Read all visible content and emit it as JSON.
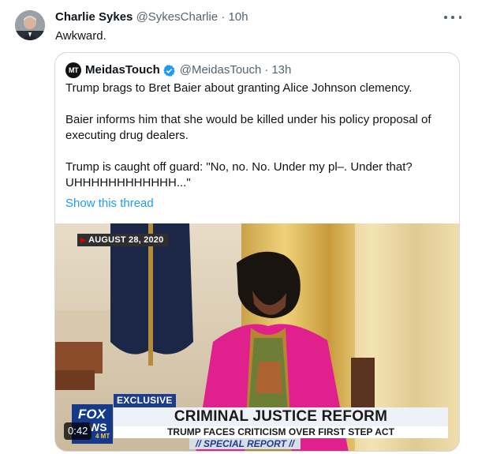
{
  "tweet": {
    "author_name": "Charlie Sykes",
    "author_handle": "@SykesCharlie",
    "separator": "·",
    "time": "10h",
    "text": "Awkward."
  },
  "quote": {
    "avatar_initials": "MT",
    "author_name": "MeidasTouch",
    "author_handle": "@MeidasTouch",
    "separator": "·",
    "time": "13h",
    "paragraphs": [
      "Trump brags to Bret Baier about granting Alice Johnson clemency.",
      "Baier informs him that she would be killed under his policy proposal of executing drug dealers.",
      "Trump is caught off guard: \"No, no. No. Under my pl–. Under that? UHHHHHHHHHHHH...\""
    ],
    "thread_link": "Show this thread"
  },
  "video": {
    "date_tag": "AUGUST 28, 2020",
    "exclusive": "EXCLUSIVE",
    "logo_line1": "FOX",
    "logo_line2": "WS",
    "logo_line3": "4 MT",
    "headline": "CRIMINAL JUSTICE REFORM",
    "subheadline": "TRUMP FACES CRITICISM OVER FIRST STEP ACT",
    "special": "// SPECIAL REPORT //",
    "duration": "0:42"
  },
  "icons": {
    "more": "more-horizontal-icon",
    "verified": "verified-badge-icon"
  },
  "colors": {
    "link": "#1d9bf0",
    "secondary_text": "#536471",
    "border": "#cfd9de",
    "blazer_pink": "#e0208c"
  }
}
